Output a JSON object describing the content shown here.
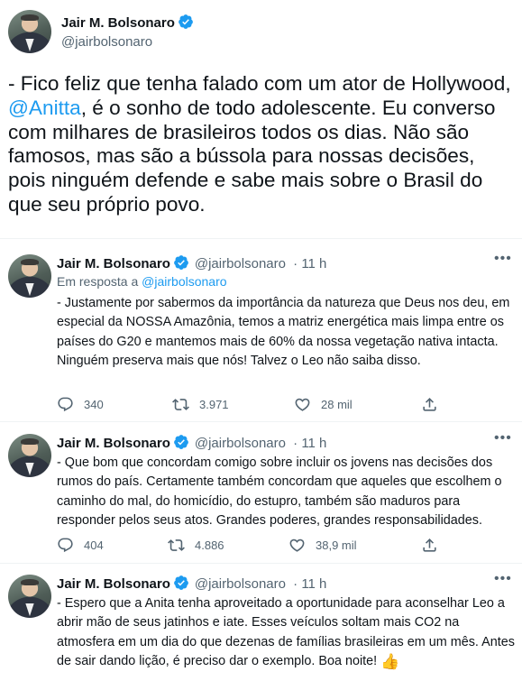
{
  "main_tweet": {
    "author_name": "Jair M. Bolsonaro",
    "author_handle": "@jairbolsonaro",
    "text_before_mention": "- Fico feliz que tenha falado com um ator de Hollywood, ",
    "mention": "@Anitta",
    "text_after_mention": ", é o sonho de todo adolescente. Eu converso com milhares de brasileiros todos os dias. Não são famosos, mas são a bússola para nossas decisões, pois ninguém defende e sabe mais sobre o Brasil do que seu próprio povo."
  },
  "replies": [
    {
      "author_name": "Jair M. Bolsonaro",
      "author_handle": "@jairbolsonaro",
      "time": "· 11 h",
      "reply_prefix": "Em resposta a ",
      "reply_to": "@jairbolsonaro",
      "text": "- Justamente por sabermos da importância da natureza que Deus nos deu, em especial da NOSSA Amazônia, temos a matriz energética mais limpa entre os países do G20 e mantemos mais de 60% da nossa vegetação nativa intacta. Ninguém preserva mais que nós! Talvez o Leo não saiba disso.",
      "replies_count": "340",
      "retweets_count": "3.971",
      "likes_count": "28 mil"
    },
    {
      "author_name": "Jair M. Bolsonaro",
      "author_handle": "@jairbolsonaro",
      "time": "· 11 h",
      "text": "- Que bom que concordam comigo sobre incluir os jovens nas decisões dos rumos do país. Certamente também concordam que aqueles que escolhem o caminho do mal, do homicídio, do estupro, também são maduros para responder pelos seus atos. Grandes poderes, grandes responsabilidades.",
      "replies_count": "404",
      "retweets_count": "4.886",
      "likes_count": "38,9 mil"
    },
    {
      "author_name": "Jair M. Bolsonaro",
      "author_handle": "@jairbolsonaro",
      "time": "· 11 h",
      "text": "- Espero que a Anita tenha aproveitado a oportunidade para aconselhar Leo a abrir mão de seus jatinhos e iate. Esses veículos soltam mais CO2 na atmosfera em um dia do que dezenas de famílias brasileiras em um mês. Antes de sair dando lição, é preciso dar o exemplo. Boa noite!",
      "emoji": "👍"
    }
  ],
  "icons": {
    "verified": "verified-badge-icon",
    "more": "more-options-icon",
    "reply": "reply-icon",
    "retweet": "retweet-icon",
    "like": "heart-icon",
    "share": "share-icon"
  },
  "colors": {
    "accent": "#1d9bf0",
    "text": "#0f1419",
    "secondary": "#536471"
  }
}
